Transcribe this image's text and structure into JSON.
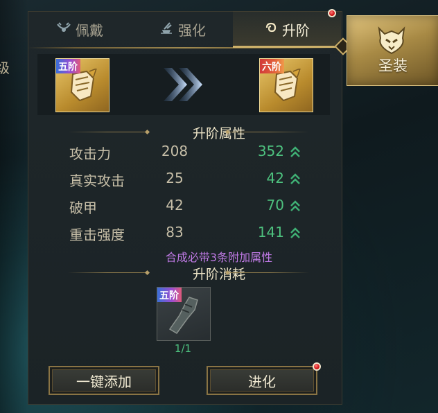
{
  "left_edge_text": "级",
  "tabs": [
    {
      "label": "佩戴",
      "icon": "necklace-icon"
    },
    {
      "label": "强化",
      "icon": "forge-icon"
    },
    {
      "label": "升阶",
      "icon": "swirl-icon",
      "active": true
    }
  ],
  "side_tab": {
    "label": "圣装",
    "icon": "helmet-emblem-icon"
  },
  "upgrade": {
    "from": {
      "tier": "五阶"
    },
    "to": {
      "tier": "六阶"
    }
  },
  "attributes_title": "升阶属性",
  "attributes": [
    {
      "name": "攻击力",
      "old": "208",
      "new": "352"
    },
    {
      "name": "真实攻击",
      "old": "25",
      "new": "42"
    },
    {
      "name": "破甲",
      "old": "42",
      "new": "70"
    },
    {
      "name": "重击强度",
      "old": "83",
      "new": "141"
    }
  ],
  "note": "合成必带3条附加属性",
  "cost_title": "升阶消耗",
  "cost_item": {
    "tier": "五阶",
    "count": "1/1"
  },
  "buttons": {
    "auto_add": "一键添加",
    "evolve": "进化"
  },
  "colors": {
    "gold": "#cdb16a",
    "green": "#4ec27f",
    "purple": "#c07ae6",
    "red_dot": "#d01515"
  }
}
